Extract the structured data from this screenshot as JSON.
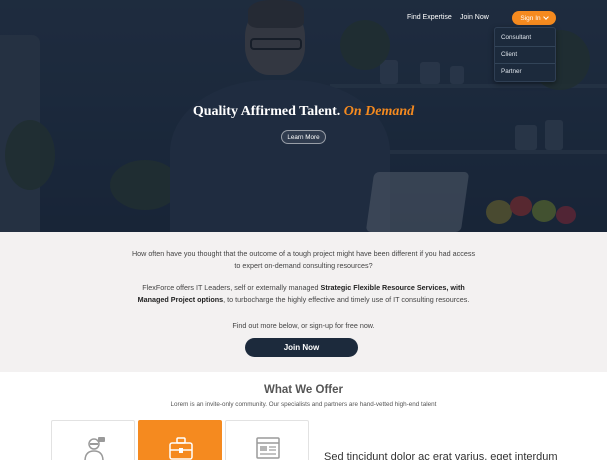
{
  "nav": {
    "find_expertise": "Find Expertise",
    "join_now": "Join Now",
    "sign_in": "Sign In",
    "dropdown": [
      "Consultant",
      "Client",
      "Partner"
    ]
  },
  "hero": {
    "title_main": "Quality Affirmed Talent.",
    "title_accent": "On Demand",
    "learn_more": "Learn More"
  },
  "intro": {
    "line1": "How often have you thought that the outcome of a tough project might have been different if you had access",
    "line2": "to expert  on-demand consulting resources?",
    "line3_pre": "FlexForce offers IT Leaders, self or externally managed ",
    "line3_bold": "Strategic Flexible Resource Services, with",
    "line4_bold": "Managed Project options",
    "line4_post": ", to turbocharge the highly effective and timely use of IT consulting resources.",
    "line5": "Find out more below, or sign-up for free now.",
    "join_button": "Join Now"
  },
  "offer": {
    "title": "What We Offer",
    "subtitle": "Lorem is an invite-only community. Our specialists and partners are hand-vetted high-end talent",
    "cards": [
      {
        "icon": "consultant-icon",
        "active": false
      },
      {
        "icon": "toolbox-icon",
        "active": true
      },
      {
        "icon": "browser-icon",
        "active": false
      }
    ],
    "side_text": "Sed tincidunt dolor ac erat varius, eget interdum"
  },
  "colors": {
    "accent": "#f58a1f",
    "navy": "#1c2a3c"
  }
}
